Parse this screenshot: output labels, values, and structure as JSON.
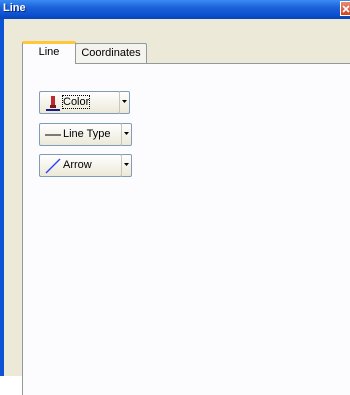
{
  "window": {
    "title": "Line"
  },
  "tabs": [
    {
      "label": "Line",
      "active": true
    },
    {
      "label": "Coordinates",
      "active": false
    }
  ],
  "buttons": {
    "color": {
      "label": "Color",
      "icon": "paint-bucket-icon"
    },
    "line_type": {
      "label": "Line Type",
      "icon": "horizontal-line-icon"
    },
    "arrow": {
      "label": "Arrow",
      "icon": "diagonal-line-icon"
    }
  },
  "colors": {
    "titlebar": "#0a4fd0",
    "window_bg": "#ece9d8",
    "active_tab_accent": "#ffc83c",
    "arrow_line": "#2a3cff"
  }
}
